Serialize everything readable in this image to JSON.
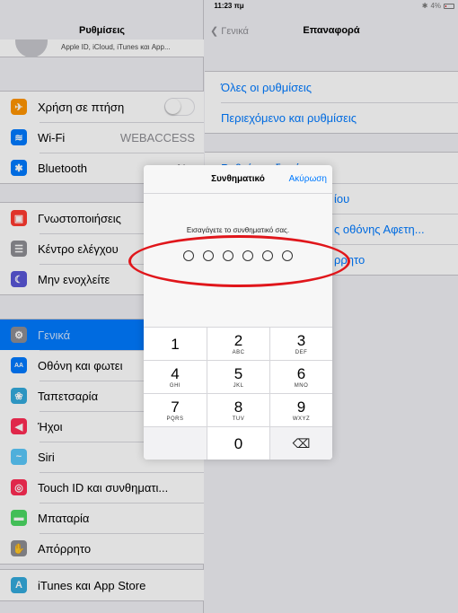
{
  "status": {
    "device": "iPad",
    "time": "11:23 πμ",
    "battery": "4%",
    "bluetooth_icon": "bluetooth-icon",
    "wifi_icon": "wifi-icon"
  },
  "master": {
    "title": "Ρυθμίσεις",
    "profile_subtitle": "Apple ID, iCloud, iTunes και App...",
    "group1": [
      {
        "label": "Χρήση σε πτήση",
        "icon": "airplane-icon",
        "color": "#ff9500",
        "toggle": false
      },
      {
        "label": "Wi-Fi",
        "icon": "wifi-icon",
        "color": "#007aff",
        "value": "WEBACCESS"
      },
      {
        "label": "Bluetooth",
        "icon": "bluetooth-icon",
        "color": "#007aff",
        "value": "Ναι"
      }
    ],
    "group2": [
      {
        "label": "Γνωστοποιήσεις",
        "icon": "notifications-icon",
        "color": "#ff3b30"
      },
      {
        "label": "Κέντρο ελέγχου",
        "icon": "control-center-icon",
        "color": "#8e8e93"
      },
      {
        "label": "Μην ενοχλείτε",
        "icon": "moon-icon",
        "color": "#5856d6"
      }
    ],
    "group3": [
      {
        "label": "Γενικά",
        "icon": "gear-icon",
        "color": "#8e8e93",
        "selected": true
      },
      {
        "label": "Οθόνη και φωτει",
        "icon": "display-icon",
        "color": "#007aff"
      },
      {
        "label": "Ταπετσαρία",
        "icon": "wallpaper-icon",
        "color": "#34aadc"
      },
      {
        "label": "Ήχοι",
        "icon": "speaker-icon",
        "color": "#ff2d55"
      },
      {
        "label": "Siri",
        "icon": "siri-icon",
        "color": "#5ac8fa"
      },
      {
        "label": "Touch ID και συνθηματι...",
        "icon": "fingerprint-icon",
        "color": "#ff2d55"
      },
      {
        "label": "Μπαταρία",
        "icon": "battery-icon",
        "color": "#4cd964"
      },
      {
        "label": "Απόρρητο",
        "icon": "hand-icon",
        "color": "#8e8e93"
      }
    ],
    "group4": [
      {
        "label": "iTunes και App Store",
        "icon": "app-store-icon",
        "color": "#34aadc"
      }
    ]
  },
  "detail": {
    "back": "Γενικά",
    "title": "Επαναφορά",
    "group1": [
      "Όλες οι ρυθμίσεις",
      "Περιεχόμενο και ρυθμίσεις"
    ],
    "group2": [
      "Ρυθμίσεις δικτύου",
      "ίου",
      "ς οθόνης Αφετη...",
      "ρρητο"
    ]
  },
  "passcode": {
    "title": "Συνθηματικό",
    "cancel": "Ακύρωση",
    "prompt": "Εισαγάγετε το συνθηματικό σας.",
    "digits_entered": 0,
    "digits_total": 6,
    "keys": [
      {
        "num": "1",
        "letters": ""
      },
      {
        "num": "2",
        "letters": "ABC"
      },
      {
        "num": "3",
        "letters": "DEF"
      },
      {
        "num": "4",
        "letters": "GHI"
      },
      {
        "num": "5",
        "letters": "JKL"
      },
      {
        "num": "6",
        "letters": "MNO"
      },
      {
        "num": "7",
        "letters": "PQRS"
      },
      {
        "num": "8",
        "letters": "TUV"
      },
      {
        "num": "9",
        "letters": "WXYZ"
      },
      {
        "num": "",
        "letters": ""
      },
      {
        "num": "0",
        "letters": ""
      },
      {
        "num": "⌫",
        "letters": "",
        "icon": "delete-icon"
      }
    ]
  },
  "annotation_color": "#e0161b"
}
